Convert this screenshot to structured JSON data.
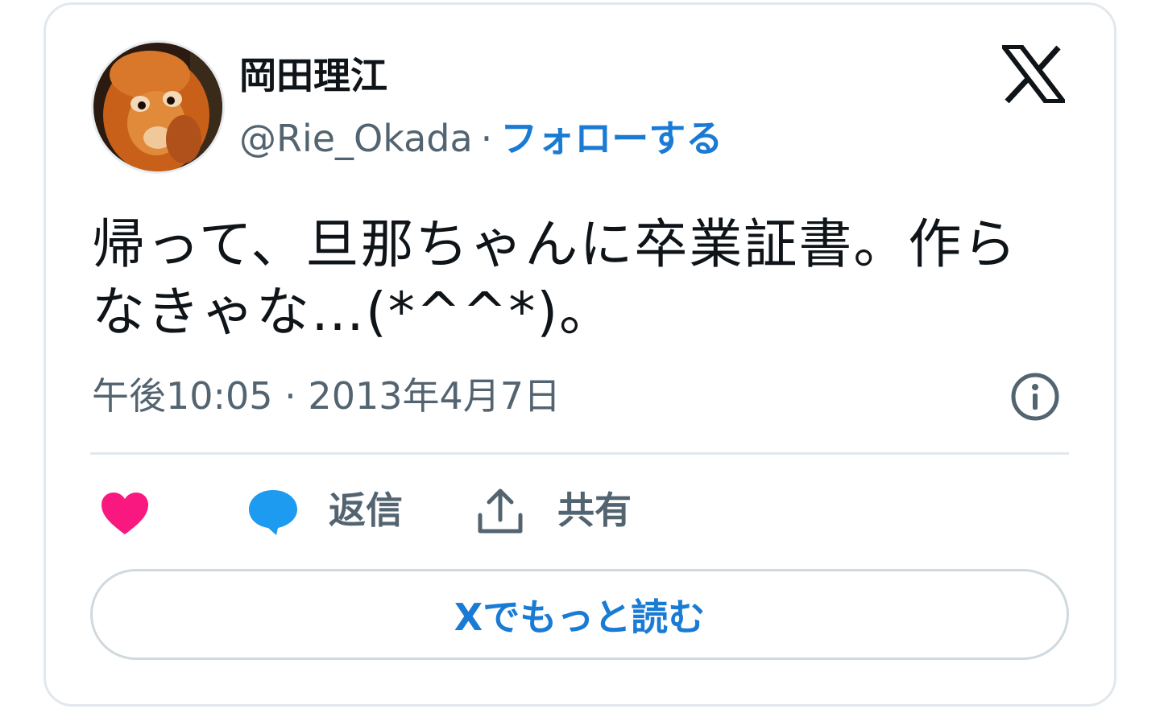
{
  "author": {
    "name": "岡田理江",
    "handle": "@Rie_Okada",
    "separator": "·",
    "follow_label": "フォローする"
  },
  "tweet": {
    "text_line1": "帰って、旦那ちゃんに卒業証書。作ら",
    "text_line2": "なきゃな…(*^^*)。",
    "timestamp": "午後10:05 · 2013年4月7日"
  },
  "actions": {
    "reply_label": "返信",
    "share_label": "共有"
  },
  "read_more_label": "Xでもっと読む",
  "icons": {
    "logo": "x-logo-icon",
    "info": "info-icon",
    "like": "heart-icon",
    "reply": "speech-bubble-icon",
    "share": "share-upload-icon"
  },
  "colors": {
    "link": "#1a7bd4",
    "heart": "#f91880",
    "reply": "#1d9bf0",
    "text": "#0f1419",
    "secondary": "#536471",
    "border": "#e1e8ed"
  }
}
